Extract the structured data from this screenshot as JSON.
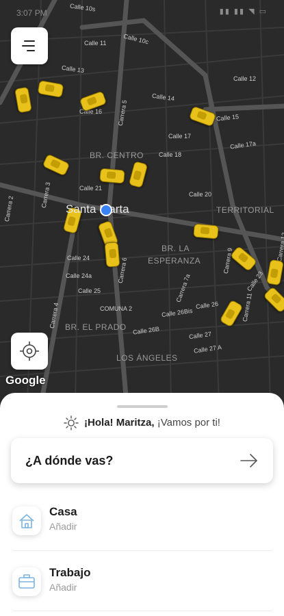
{
  "status_bar": {
    "time": "3:07 PM",
    "icons_text": "▮▮ ▮▮ ◥ ▭"
  },
  "map": {
    "city_label": "Santa Marta",
    "districts": [
      "BR. CENTRO",
      "TERRITORIAL",
      "BR. LA",
      "ESPERANZA",
      "BR. EL PRADO",
      "LOS ÁNGELES",
      "COMUNA 2"
    ],
    "streets": [
      "Calle 10s",
      "Calle 10c",
      "Calle 11",
      "Calle 13",
      "Calle 12",
      "Calle 16",
      "Calle 14",
      "Calle 15",
      "Calle 17",
      "Calle 17a",
      "Calle 18",
      "Calle 21",
      "Calle 20",
      "Carrera 5",
      "Carrera 3",
      "Carrera 2",
      "Calle 24",
      "Calle 24a",
      "Calle 25",
      "Carrera 6",
      "Carrera 4",
      "Carrera 7a",
      "Calle 26Bis",
      "Calle 26B",
      "Calle 26",
      "Calle 27",
      "Calle 27 A",
      "Carrera 11",
      "Carrera 9",
      "Calle 23",
      "Carrera 12"
    ],
    "attribution": "Google"
  },
  "sheet": {
    "greeting_bold": "¡Hola! Maritza,",
    "greeting_rest": " ¡Vamos por ti!",
    "destination_placeholder": "¿A dónde vas?",
    "places": [
      {
        "title": "Casa",
        "subtitle": "Añadir",
        "icon": "home-icon"
      },
      {
        "title": "Trabajo",
        "subtitle": "Añadir",
        "icon": "briefcase-icon"
      }
    ]
  },
  "colors": {
    "taxi": "#e8c21a",
    "map_bg": "#2a2a2a",
    "location_dot": "#3b82f6"
  }
}
